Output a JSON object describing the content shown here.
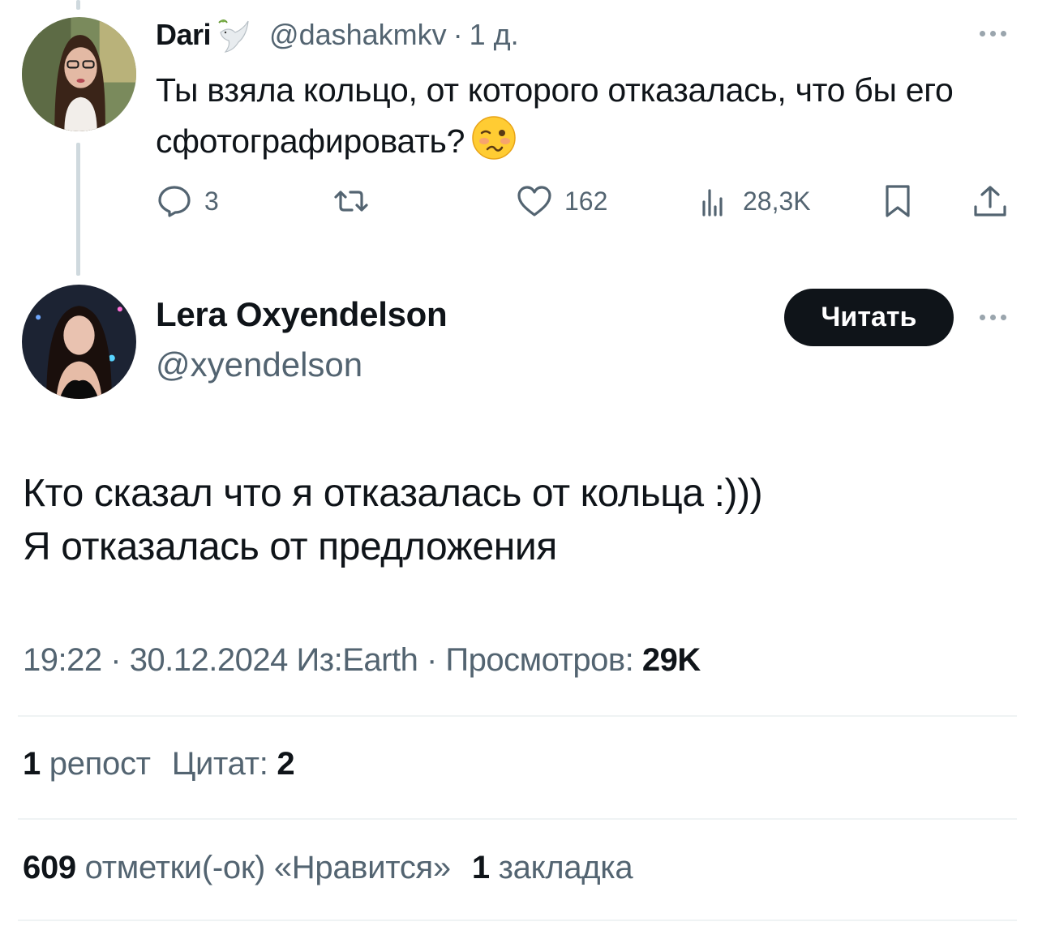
{
  "reply": {
    "name": "Dari",
    "handle": "@dashakmkv",
    "separator": "·",
    "time": "1 д.",
    "text": "Ты взяла кольцо, от которого отказалась, что бы его сфотографировать?",
    "actions": {
      "replies": "3",
      "reposts": "",
      "likes": "162",
      "views": "28,3K"
    }
  },
  "tweet": {
    "name": "Lera Oxyendelson",
    "handle": "@xyendelson",
    "follow_label": "Читать",
    "lines": [
      "Кто сказал что я отказалась от кольца :)))",
      "Я отказалась от предложения"
    ],
    "meta": {
      "time": "19:22",
      "date": "30.12.2024",
      "source": "Из:Earth",
      "views_label": "Просмотров:",
      "views_value": "29K"
    },
    "stats": {
      "reposts_count": "1",
      "reposts_label": "репост",
      "quotes_label": "Цитат:",
      "quotes_count": "2",
      "likes_count": "609",
      "likes_label": "отметки(-ок) «Нравится»",
      "bookmarks_count": "1",
      "bookmarks_label": "закладка"
    }
  },
  "icons": {
    "reply": "speech-bubble-icon",
    "repost": "repost-icon",
    "like": "heart-icon",
    "views": "bar-chart-icon",
    "bookmark": "bookmark-icon",
    "share": "share-icon",
    "more": "more-dots-icon",
    "badge": "dove-emoji-icon",
    "emoji": "woozy-face-emoji"
  },
  "colors": {
    "text": "#0f1419",
    "secondary": "#536471",
    "button_bg": "#0f1419",
    "thread_line": "#cfd9de"
  }
}
